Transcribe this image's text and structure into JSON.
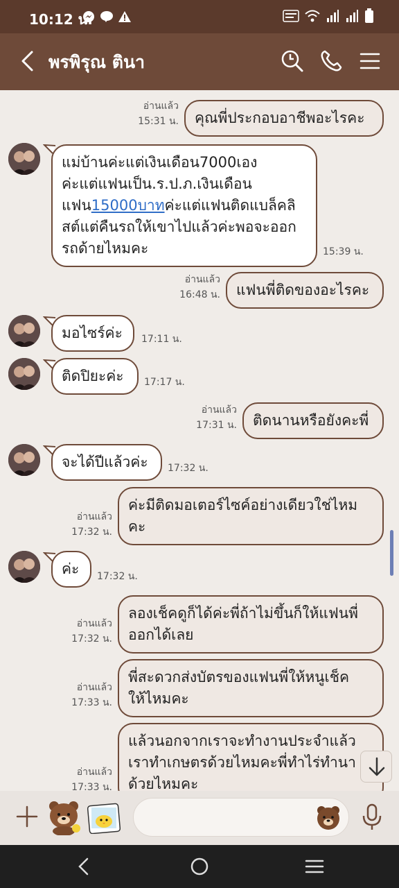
{
  "status_bar": {
    "time": "10:12 น."
  },
  "header": {
    "title": "พรพิรุณ ตินา"
  },
  "messages": [
    {
      "read": "อ่านแล้ว",
      "time": "15:31 น.",
      "text": "คุณพี่ประกอบอาชีพอะไรคะ"
    },
    {
      "time": "15:39 น.",
      "lines": [
        "แม่บ้านค่ะแต่เงินเดือน7000เอง",
        "ค่ะแต่แฟนเป็น.ร.ป.ภ.เงินเดือน"
      ],
      "pre": "แฟน",
      "link": "15000บาท",
      "post": "ค่ะแต่แฟนติดแบล็คลิ",
      "lines2": [
        "สต์แต่คืนรถให้เขาไปแล้วค่ะพอจะออก",
        "รถด้ายไหมคะ"
      ]
    },
    {
      "read": "อ่านแล้ว",
      "time": "16:48 น.",
      "text": "แฟนพี่ติดของอะไรคะ"
    },
    {
      "time": "17:11 น.",
      "text": "มอไซร์ค่ะ"
    },
    {
      "time": "17:17 น.",
      "text": "ติดปิยะค่ะ"
    },
    {
      "read": "อ่านแล้ว",
      "time": "17:31 น.",
      "text": "ติดนานหรือยังคะพี่"
    },
    {
      "time": "17:32 น.",
      "text": "จะได้ปีแล้วค่ะ"
    },
    {
      "read": "อ่านแล้ว",
      "time": "17:32 น.",
      "lines": [
        "ค่ะมีติดมอเตอร์ไซค์อย่างเดียวใช่ไหม",
        "คะ"
      ]
    },
    {
      "time": "17:32 น.",
      "text": "ค่ะ"
    },
    {
      "read": "อ่านแล้ว",
      "time": "17:32 น.",
      "lines": [
        "ลองเช็คดูก็ได้ค่ะพี่ถ้าไม่ขึ้นก็ให้แฟนพี่",
        "ออกได้เลย"
      ]
    },
    {
      "read": "อ่านแล้ว",
      "time": "17:33 น.",
      "lines": [
        "พี่สะดวกส่งบัตรของแฟนพี่ให้หนูเช็ค",
        "ให้ไหมคะ"
      ]
    },
    {
      "read": "อ่านแล้ว",
      "time": "17:33 น.",
      "lines": [
        "แล้วนอกจากเราจะทำงานประจำแล้ว",
        "เราทำเกษตรด้วยไหมคะพี่ทำไร่ทำนา",
        "ด้วยไหมคะ"
      ]
    }
  ],
  "colors": {
    "header": "#6e4a39",
    "status": "#5b3a2c",
    "background": "#f0ece8",
    "link": "#2f6dc7"
  }
}
